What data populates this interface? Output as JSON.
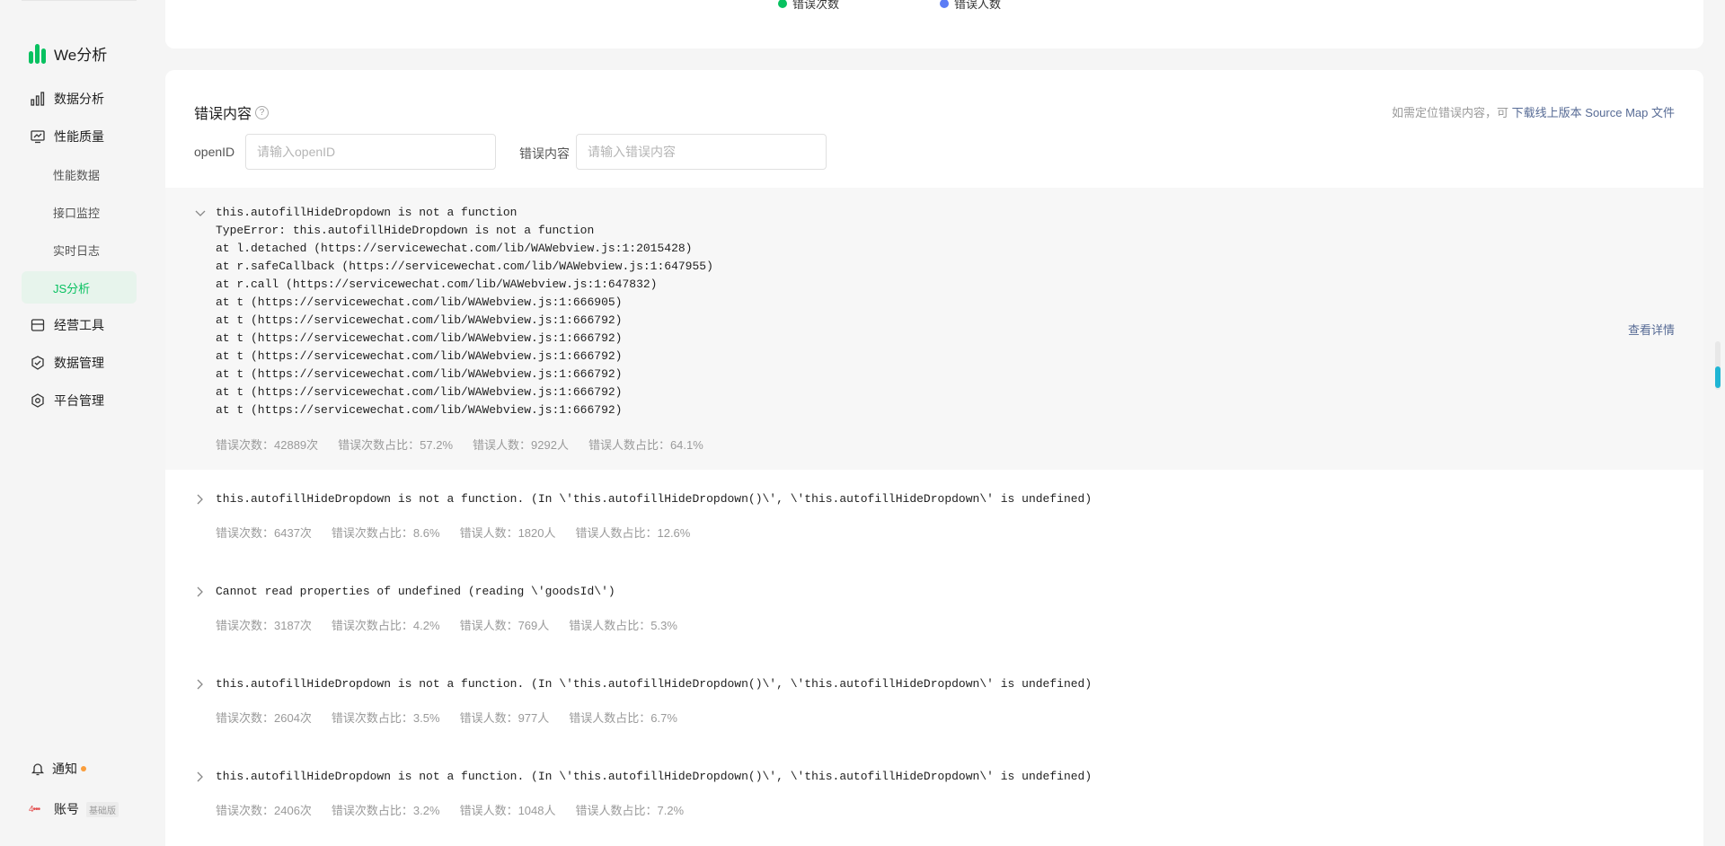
{
  "legend": {
    "items": [
      {
        "label": "错误次数",
        "color": "#07c160"
      },
      {
        "label": "错误人数",
        "color": "#5b7cf5"
      }
    ]
  },
  "brand": {
    "name": "We分析"
  },
  "sidebar": {
    "items": [
      {
        "label": "数据分析",
        "icon": "bar-chart-icon"
      },
      {
        "label": "性能质量",
        "icon": "monitor-icon"
      },
      {
        "label": "经营工具",
        "icon": "shop-icon"
      },
      {
        "label": "数据管理",
        "icon": "shield-check-icon"
      },
      {
        "label": "平台管理",
        "icon": "gear-icon"
      }
    ],
    "sub_items": [
      {
        "label": "性能数据"
      },
      {
        "label": "接口监控"
      },
      {
        "label": "实时日志"
      },
      {
        "label": "JS分析",
        "active": true
      }
    ],
    "notify": "通知",
    "account": "账号",
    "account_badge": "基础版",
    "avatar_text": "4•••"
  },
  "section": {
    "title": "错误内容",
    "help_icon": "?",
    "hint_prefix": "如需定位错误内容，可",
    "hint_link": "下载线上版本 Source Map 文件"
  },
  "filters": {
    "openid_label": "openID",
    "openid_placeholder": "请输入openID",
    "content_label": "错误内容",
    "content_placeholder": "请输入错误内容"
  },
  "errors": [
    {
      "expanded": true,
      "text": "this.autofillHideDropdown is not a function\nTypeError: this.autofillHideDropdown is not a function\nat l.detached (https://servicewechat.com/lib/WAWebview.js:1:2015428)\nat r.safeCallback (https://servicewechat.com/lib/WAWebview.js:1:647955)\nat r.call (https://servicewechat.com/lib/WAWebview.js:1:647832)\nat t (https://servicewechat.com/lib/WAWebview.js:1:666905)\nat t (https://servicewechat.com/lib/WAWebview.js:1:666792)\nat t (https://servicewechat.com/lib/WAWebview.js:1:666792)\nat t (https://servicewechat.com/lib/WAWebview.js:1:666792)\nat t (https://servicewechat.com/lib/WAWebview.js:1:666792)\nat t (https://servicewechat.com/lib/WAWebview.js:1:666792)\nat t (https://servicewechat.com/lib/WAWebview.js:1:666792)",
      "count": "错误次数：42889次",
      "count_ratio": "错误次数占比：57.2%",
      "users": "错误人数：9292人",
      "users_ratio": "错误人数占比：64.1%",
      "detail": "查看详情"
    },
    {
      "expanded": false,
      "text": "this.autofillHideDropdown is not a function. (In \\'this.autofillHideDropdown()\\', \\'this.autofillHideDropdown\\' is undefined)",
      "count": "错误次数：6437次",
      "count_ratio": "错误次数占比：8.6%",
      "users": "错误人数：1820人",
      "users_ratio": "错误人数占比：12.6%"
    },
    {
      "expanded": false,
      "text": "Cannot read properties of undefined (reading \\'goodsId\\')",
      "count": "错误次数：3187次",
      "count_ratio": "错误次数占比：4.2%",
      "users": "错误人数：769人",
      "users_ratio": "错误人数占比：5.3%"
    },
    {
      "expanded": false,
      "text": "this.autofillHideDropdown is not a function. (In \\'this.autofillHideDropdown()\\', \\'this.autofillHideDropdown\\' is undefined)",
      "count": "错误次数：2604次",
      "count_ratio": "错误次数占比：3.5%",
      "users": "错误人数：977人",
      "users_ratio": "错误人数占比：6.7%"
    },
    {
      "expanded": false,
      "text": "this.autofillHideDropdown is not a function. (In \\'this.autofillHideDropdown()\\', \\'this.autofillHideDropdown\\' is undefined)",
      "count": "错误次数：2406次",
      "count_ratio": "错误次数占比：3.2%",
      "users": "错误人数：1048人",
      "users_ratio": "错误人数占比：7.2%"
    }
  ]
}
